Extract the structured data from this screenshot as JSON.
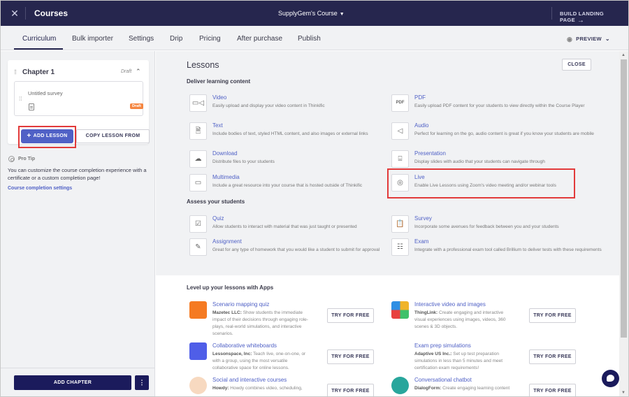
{
  "topbar": {
    "title": "Courses",
    "course_name": "SupplyGem's Course",
    "build_landing_page": "BUILD LANDING PAGE"
  },
  "tabs": [
    {
      "label": "Curriculum",
      "active": true
    },
    {
      "label": "Bulk importer"
    },
    {
      "label": "Settings"
    },
    {
      "label": "Drip"
    },
    {
      "label": "Pricing"
    },
    {
      "label": "After purchase"
    },
    {
      "label": "Publish"
    }
  ],
  "preview_label": "PREVIEW",
  "sidebar": {
    "chapter": {
      "title": "Chapter 1",
      "status": "Draft",
      "lessons": [
        {
          "title": "Untitled survey",
          "badge": "Draft"
        }
      ]
    },
    "add_lesson": "ADD LESSON",
    "copy_lesson_from": "COPY LESSON FROM",
    "pro_tip": {
      "label": "Pro Tip",
      "text": "You can customize the course completion experience with a certificate or a custom completion page!",
      "link": "Course completion settings"
    },
    "add_chapter": "ADD CHAPTER",
    "more": "⋮"
  },
  "lessons_panel": {
    "title": "Lessons",
    "close": "CLOSE",
    "deliver_heading": "Deliver learning content",
    "deliver": [
      {
        "name": "Video",
        "desc": "Easily upload and display your video content in Thinkific",
        "icon": "video-icon"
      },
      {
        "name": "PDF",
        "desc": "Easily upload PDF content for your students to view directly within the Course Player",
        "icon": "pdf-icon"
      },
      {
        "name": "Text",
        "desc": "Include bodies of text, styled HTML content, and also images or external links",
        "icon": "text-icon"
      },
      {
        "name": "Audio",
        "desc": "Perfect for learning on the go, audio content is great if you know your students are mobile",
        "icon": "audio-icon"
      },
      {
        "name": "Download",
        "desc": "Distribute files to your students",
        "icon": "download-icon"
      },
      {
        "name": "Presentation",
        "desc": "Display slides with audio that your students can navigate through",
        "icon": "presentation-icon"
      },
      {
        "name": "Multimedia",
        "desc": "Include a great resource into your course that is hosted outside of Thinkific",
        "icon": "multimedia-icon"
      },
      {
        "name": "Live",
        "desc": "Enable Live Lessons using Zoom's video meeting and/or webinar tools",
        "icon": "live-icon"
      }
    ],
    "assess_heading": "Assess your students",
    "assess": [
      {
        "name": "Quiz",
        "desc": "Allow students to interact with material that was just taught or presented",
        "icon": "quiz-icon"
      },
      {
        "name": "Survey",
        "desc": "Incorporate some avenues for feedback between you and your students",
        "icon": "survey-icon"
      },
      {
        "name": "Assignment",
        "desc": "Great for any type of homework that you would like a student to submit for approval",
        "icon": "assignment-icon"
      },
      {
        "name": "Exam",
        "desc": "Integrate with a professional exam tool called Brillium to deliver tests with these requirements",
        "icon": "exam-icon"
      }
    ]
  },
  "apps": {
    "heading": "Level up your lessons with Apps",
    "try_label": "TRY FOR FREE",
    "items": [
      {
        "name": "Scenario mapping quiz",
        "vendor": "Mazetec LLC:",
        "desc": "Show students the immediate impact of their decisions through engaging role-plays, real-world simulations, and interactive scenarios."
      },
      {
        "name": "Interactive video and images",
        "vendor": "ThingLink:",
        "desc": "Create engaging and interactive visual experiences using images, videos, 360 scenes & 3D objects."
      },
      {
        "name": "Collaborative whiteboards",
        "vendor": "Lessonspace, Inc:",
        "desc": "Teach live, one-on-one, or with a group, using the most versatile collaborative space for online lessons."
      },
      {
        "name": "Exam prep simulations",
        "vendor": "Adaptive US Inc.:",
        "desc": "Set up test preparation simulations in less than 5 minutes and meet certification exam requirements!"
      },
      {
        "name": "Social and interactive courses",
        "vendor": "Howdy:",
        "desc": "Howdy combines video, scheduling,"
      },
      {
        "name": "Conversational chatbot",
        "vendor": "DialogForm:",
        "desc": "Create engaging learning content"
      }
    ]
  },
  "colors": {
    "topbar": "#26264e",
    "accent": "#5061c6",
    "primary_dark": "#1b1b5c",
    "highlight": "#e23a3a",
    "draft_badge": "#f5853f"
  }
}
